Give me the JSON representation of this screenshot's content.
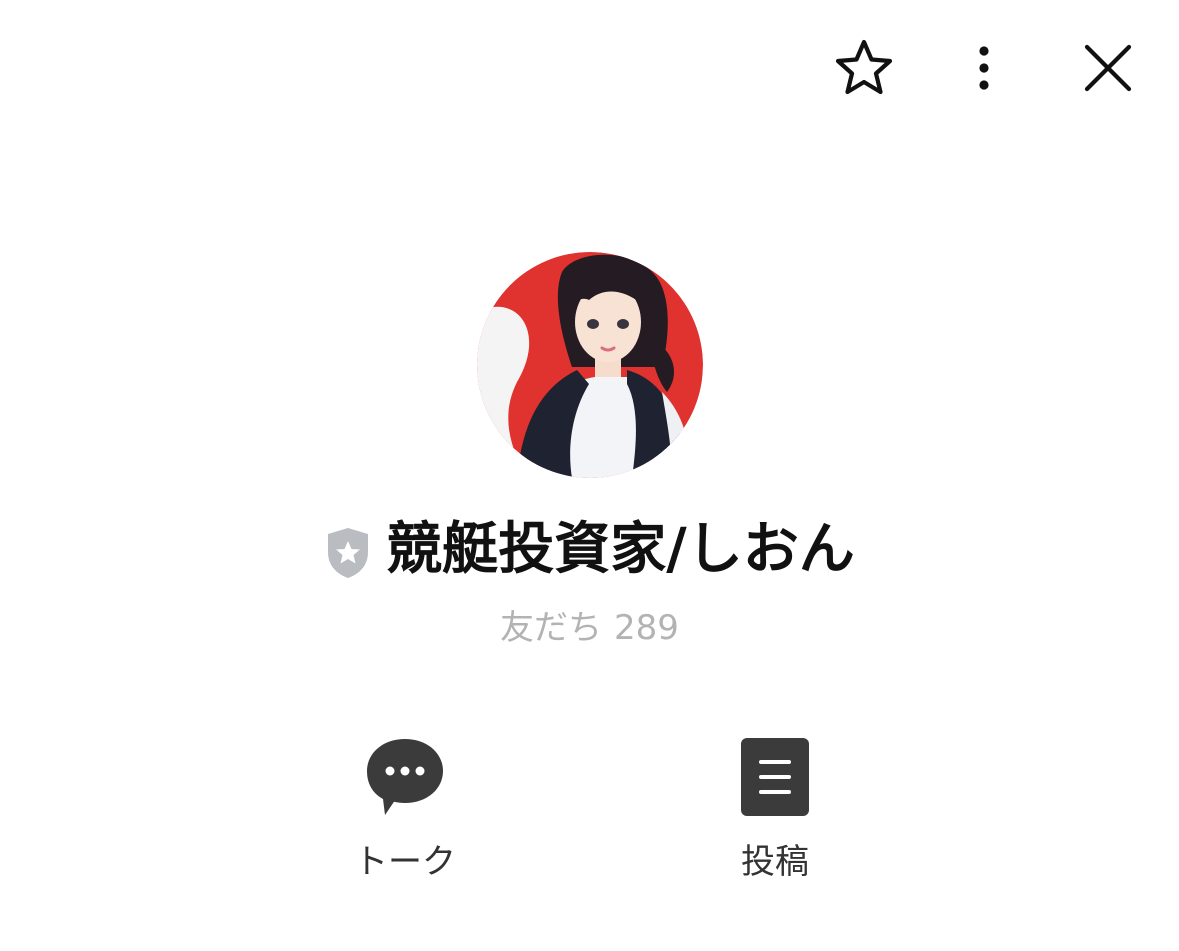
{
  "header": {
    "icons": {
      "favorite": "star-outline-icon",
      "more": "vertical-dots-icon",
      "close": "close-x-icon"
    }
  },
  "profile": {
    "name": "競艇投資家/しおん",
    "badge_icon": "verified-shield-icon",
    "friends_label": "友だち",
    "friends_count": "289",
    "avatar_icon": "anime-woman-avatar"
  },
  "actions": [
    {
      "label": "トーク",
      "icon": "chat-bubble-icon"
    },
    {
      "label": "投稿",
      "icon": "post-document-icon"
    }
  ],
  "colors": {
    "text": "#111111",
    "muted": "#b3b3b3",
    "icon_dark": "#3b3b3b",
    "badge_gray": "#b9bcc0",
    "avatar_red": "#e0322e"
  }
}
